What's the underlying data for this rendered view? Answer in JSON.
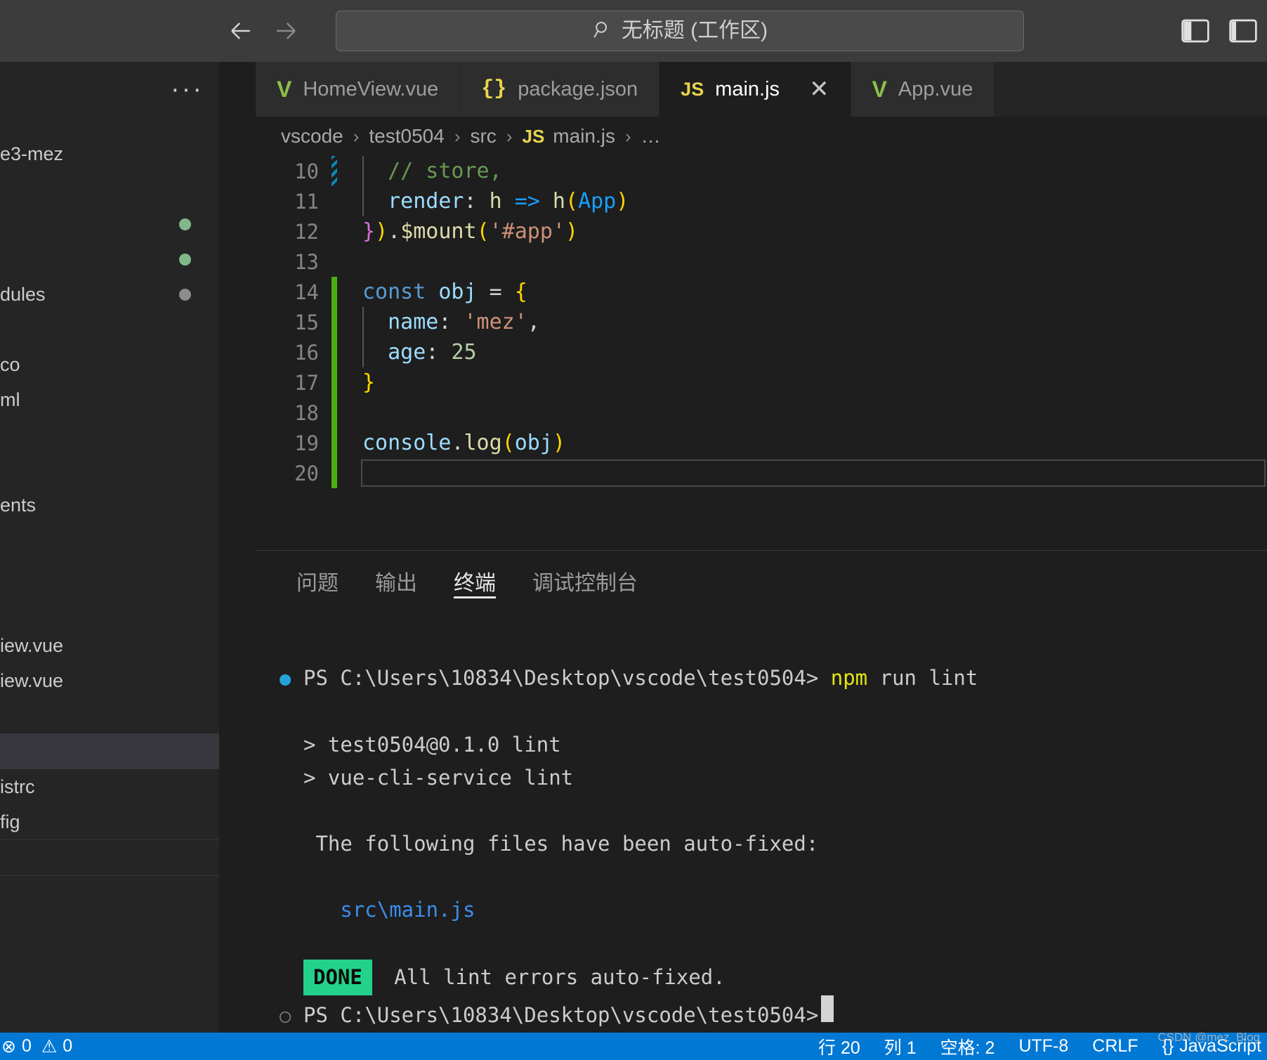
{
  "titlebar": {
    "back_icon": "arrow-left-icon",
    "forward_icon": "arrow-right-icon",
    "search_icon": "search-icon",
    "title": "无标题 (工作区)",
    "layout_panel_icon": "toggle-panel-icon",
    "layout_sidebar_icon": "toggle-sidebar-icon"
  },
  "sidebar": {
    "more_actions": "···",
    "items": [
      {
        "label": "e3-mez",
        "dot": ""
      },
      {
        "label": "",
        "dot": "#81b88b"
      },
      {
        "label": "",
        "dot": "#81b88b"
      },
      {
        "label": "dules",
        "dot": "#8c8c8c"
      },
      {
        "label": "co",
        "dot": ""
      },
      {
        "label": "ml",
        "dot": ""
      },
      {
        "label": "ents",
        "dot": ""
      },
      {
        "label": "iew.vue",
        "dot": ""
      },
      {
        "label": "iew.vue",
        "dot": ""
      },
      {
        "label": "istrc",
        "dot": ""
      },
      {
        "label": "fig",
        "dot": ""
      }
    ]
  },
  "tabs": [
    {
      "label": "HomeView.vue",
      "icon": "vue-icon",
      "icon_text": "V",
      "active": false,
      "closable": false
    },
    {
      "label": "package.json",
      "icon": "json-icon",
      "icon_text": "{}",
      "active": false,
      "closable": false
    },
    {
      "label": "main.js",
      "icon": "js-icon",
      "icon_text": "JS",
      "active": true,
      "closable": true
    },
    {
      "label": "App.vue",
      "icon": "vue-icon",
      "icon_text": "V",
      "active": false,
      "closable": false
    }
  ],
  "tab_close_glyph": "✕",
  "breadcrumb": {
    "segments": [
      "vscode",
      "test0504",
      "src"
    ],
    "file_icon_text": "JS",
    "file": "main.js",
    "more": "…",
    "separator": "›"
  },
  "editor": {
    "lines": [
      {
        "num": "10",
        "marker": "stripe",
        "current": false,
        "tokens": [
          {
            "t": "  ",
            "c": "t-pun"
          },
          {
            "t": "// store,",
            "c": "t-com"
          }
        ]
      },
      {
        "num": "11",
        "marker": "none",
        "current": false,
        "tokens": [
          {
            "t": "  ",
            "c": "t-pun"
          },
          {
            "t": "render",
            "c": "t-var"
          },
          {
            "t": ": ",
            "c": "t-pun"
          },
          {
            "t": "h ",
            "c": "t-fn"
          },
          {
            "t": "=>",
            "c": "t-b"
          },
          {
            "t": " h",
            "c": "t-fn"
          },
          {
            "t": "(",
            "c": "t-y"
          },
          {
            "t": "App",
            "c": "t-b"
          },
          {
            "t": ")",
            "c": "t-y"
          }
        ]
      },
      {
        "num": "12",
        "marker": "none",
        "current": false,
        "tokens": [
          {
            "t": "}",
            "c": "t-p"
          },
          {
            "t": ")",
            "c": "t-y"
          },
          {
            "t": ".",
            "c": "t-pun"
          },
          {
            "t": "$mount",
            "c": "t-fn"
          },
          {
            "t": "(",
            "c": "t-y"
          },
          {
            "t": "'#app'",
            "c": "t-str"
          },
          {
            "t": ")",
            "c": "t-y"
          }
        ]
      },
      {
        "num": "13",
        "marker": "none",
        "current": false,
        "tokens": []
      },
      {
        "num": "14",
        "marker": "green",
        "current": false,
        "tokens": [
          {
            "t": "const",
            "c": "t-key"
          },
          {
            "t": " ",
            "c": "t-pun"
          },
          {
            "t": "obj",
            "c": "t-var"
          },
          {
            "t": " ",
            "c": "t-pun"
          },
          {
            "t": "=",
            "c": "t-pun"
          },
          {
            "t": " ",
            "c": "t-pun"
          },
          {
            "t": "{",
            "c": "t-y"
          }
        ]
      },
      {
        "num": "15",
        "marker": "green",
        "current": false,
        "tokens": [
          {
            "t": "  ",
            "c": "t-pun"
          },
          {
            "t": "name",
            "c": "t-var"
          },
          {
            "t": ": ",
            "c": "t-pun"
          },
          {
            "t": "'mez'",
            "c": "t-str"
          },
          {
            "t": ",",
            "c": "t-pun"
          }
        ]
      },
      {
        "num": "16",
        "marker": "green",
        "current": false,
        "tokens": [
          {
            "t": "  ",
            "c": "t-pun"
          },
          {
            "t": "age",
            "c": "t-var"
          },
          {
            "t": ": ",
            "c": "t-pun"
          },
          {
            "t": "25",
            "c": "t-num"
          }
        ]
      },
      {
        "num": "17",
        "marker": "green",
        "current": false,
        "tokens": [
          {
            "t": "}",
            "c": "t-y"
          }
        ]
      },
      {
        "num": "18",
        "marker": "green",
        "current": false,
        "tokens": []
      },
      {
        "num": "19",
        "marker": "green",
        "current": false,
        "tokens": [
          {
            "t": "console",
            "c": "t-var"
          },
          {
            "t": ".",
            "c": "t-pun"
          },
          {
            "t": "log",
            "c": "t-fn"
          },
          {
            "t": "(",
            "c": "t-y"
          },
          {
            "t": "obj",
            "c": "t-var"
          },
          {
            "t": ")",
            "c": "t-y"
          }
        ]
      },
      {
        "num": "20",
        "marker": "green",
        "current": true,
        "tokens": []
      }
    ]
  },
  "panel": {
    "tabs": [
      {
        "label": "问题",
        "active": false
      },
      {
        "label": "输出",
        "active": false
      },
      {
        "label": "终端",
        "active": true
      },
      {
        "label": "调试控制台",
        "active": false
      }
    ],
    "terminal": {
      "lines": [
        {
          "mark": "●",
          "mark_class": "dot-blue",
          "spans": [
            {
              "t": "PS C:\\Users\\10834\\Desktop\\vscode\\test0504> ",
              "c": ""
            },
            {
              "t": "npm",
              "c": "t-term-yellow"
            },
            {
              "t": " run lint",
              "c": ""
            }
          ]
        },
        {
          "mark": "",
          "mark_class": "",
          "spans": []
        },
        {
          "mark": "",
          "mark_class": "",
          "spans": [
            {
              "t": "> test0504@0.1.0 lint",
              "c": ""
            }
          ]
        },
        {
          "mark": "",
          "mark_class": "",
          "spans": [
            {
              "t": "> vue-cli-service lint",
              "c": ""
            }
          ]
        },
        {
          "mark": "",
          "mark_class": "",
          "spans": []
        },
        {
          "mark": "",
          "mark_class": "",
          "spans": [
            {
              "t": " The following files have been auto-fixed:",
              "c": ""
            }
          ]
        },
        {
          "mark": "",
          "mark_class": "",
          "spans": []
        },
        {
          "mark": "",
          "mark_class": "",
          "spans": [
            {
              "t": "   src\\main.js",
              "c": "t-term-blue"
            }
          ]
        },
        {
          "mark": "",
          "mark_class": "",
          "spans": []
        },
        {
          "mark": "",
          "mark_class": "",
          "badge": "DONE",
          "spans": [
            {
              "t": " All lint errors auto-fixed.",
              "c": ""
            }
          ]
        },
        {
          "mark": "○",
          "mark_class": "dot-gray",
          "cursor": true,
          "spans": [
            {
              "t": "PS C:\\Users\\10834\\Desktop\\vscode\\test0504>",
              "c": ""
            }
          ]
        }
      ]
    }
  },
  "statusbar": {
    "left": [
      {
        "icon": "error-icon",
        "glyph": "⊗",
        "value": "0"
      },
      {
        "icon": "warning-icon",
        "glyph": "⚠",
        "value": "0"
      }
    ],
    "right": [
      {
        "label": "行 20"
      },
      {
        "label": "列 1"
      },
      {
        "label": "空格: 2"
      },
      {
        "label": "UTF-8"
      },
      {
        "label": "CRLF"
      },
      {
        "label": "JavaScript",
        "icon_text": "{}"
      }
    ],
    "watermark": "CSDN @mez_Blog"
  },
  "colors": {
    "accent": "#0078d4",
    "titlebar_bg": "#3c3c3c",
    "sidebar_bg": "#252526",
    "editor_bg": "#1e1e1e",
    "done_badge": "#23d18b",
    "git_change": "#4caf10"
  }
}
